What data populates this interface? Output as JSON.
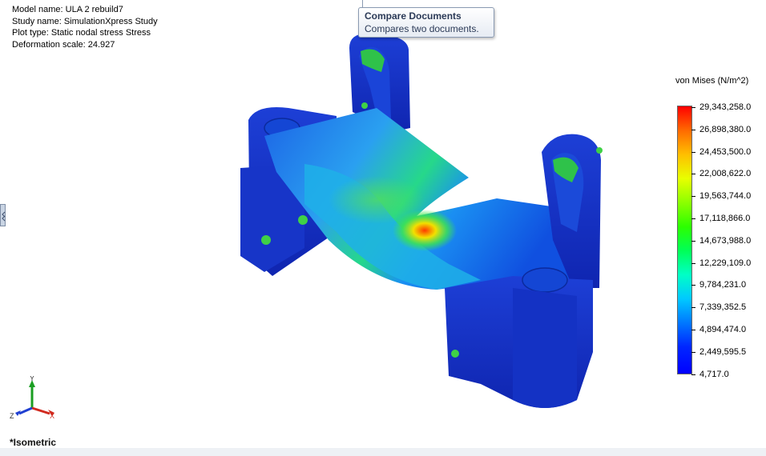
{
  "model_info": {
    "model_name": "Model name: ULA 2 rebuild7",
    "study_name": "Study name: SimulationXpress Study",
    "plot_type": "Plot type: Static nodal stress Stress",
    "deformation_scale": "Deformation scale: 24.927"
  },
  "tooltip": {
    "title": "Compare Documents",
    "description": "Compares two documents."
  },
  "legend": {
    "title": "von Mises (N/m^2)",
    "labels": [
      "29,343,258.0",
      "26,898,380.0",
      "24,453,500.0",
      "22,008,622.0",
      "19,563,744.0",
      "17,118,866.0",
      "14,673,988.0",
      "12,229,109.0",
      "9,784,231.0",
      "7,339,352.5",
      "4,894,474.0",
      "2,449,595.5",
      "4,717.0"
    ],
    "colors": {
      "max": "#ff0000",
      "min": "#0000ff"
    }
  },
  "triad": {
    "y": "Y",
    "z": "Z",
    "x": "X"
  },
  "view": {
    "label": "*Isometric"
  },
  "icons": {
    "side_panel": "collapse-handle-icon"
  }
}
